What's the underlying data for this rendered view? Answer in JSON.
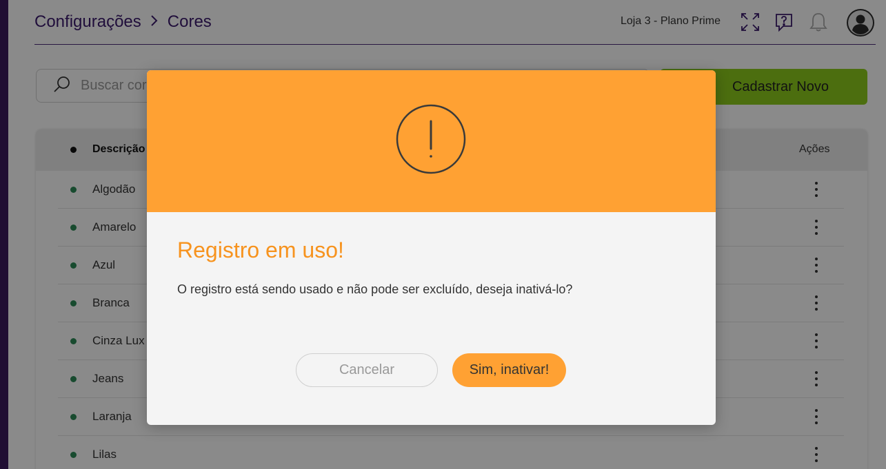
{
  "header": {
    "breadcrumb": [
      "Configurações",
      "Cores"
    ],
    "store_label": "Loja 3 - Plano Prime",
    "icons": [
      "expand-icon",
      "help-icon",
      "bell-icon",
      "user-avatar-icon"
    ]
  },
  "toolbar": {
    "search_placeholder": "Buscar cor",
    "new_button_label": "Cadastrar Novo"
  },
  "table": {
    "columns": [
      "Descrição",
      "Ações"
    ],
    "rows": [
      {
        "label": "Algodão",
        "status": "active"
      },
      {
        "label": "Amarelo",
        "status": "active"
      },
      {
        "label": "Azul",
        "status": "active"
      },
      {
        "label": "Branca",
        "status": "active"
      },
      {
        "label": "Cinza Lux",
        "status": "active"
      },
      {
        "label": "Jeans",
        "status": "active"
      },
      {
        "label": "Laranja",
        "status": "active"
      },
      {
        "label": "Lilas",
        "status": "active"
      }
    ]
  },
  "modal": {
    "icon": "warning-icon",
    "title": "Registro em uso!",
    "message": "O registro está sendo usado e não pode ser excluído, deseja inativá-lo?",
    "cancel_label": "Cancelar",
    "confirm_label": "Sim, inativar!"
  },
  "colors": {
    "brand_purple": "#3b1a6e",
    "accent_green": "#8dcc1c",
    "warning_orange": "#ffa133",
    "title_orange": "#f7931e",
    "status_active": "#2e8b57"
  }
}
